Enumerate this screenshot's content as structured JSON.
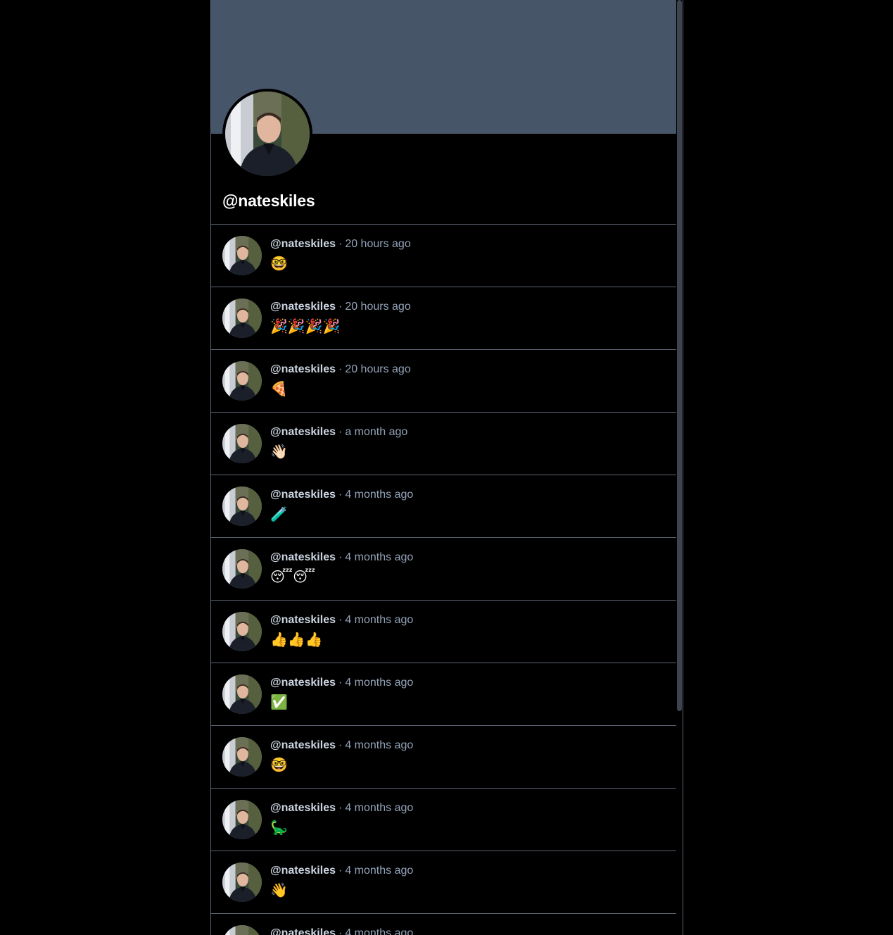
{
  "profile": {
    "handle": "@nateskiles",
    "banner_color": "#475569"
  },
  "separator": "·",
  "posts": [
    {
      "handle": "@nateskiles",
      "time": "20 hours ago",
      "body": "🤓"
    },
    {
      "handle": "@nateskiles",
      "time": "20 hours ago",
      "body": "🎉🎉🎉🎉"
    },
    {
      "handle": "@nateskiles",
      "time": "20 hours ago",
      "body": "🍕"
    },
    {
      "handle": "@nateskiles",
      "time": "a month ago",
      "body": "👋🏻"
    },
    {
      "handle": "@nateskiles",
      "time": "4 months ago",
      "body": "🧪"
    },
    {
      "handle": "@nateskiles",
      "time": "4 months ago",
      "body": "😴😴"
    },
    {
      "handle": "@nateskiles",
      "time": "4 months ago",
      "body": "👍👍👍"
    },
    {
      "handle": "@nateskiles",
      "time": "4 months ago",
      "body": "✅"
    },
    {
      "handle": "@nateskiles",
      "time": "4 months ago",
      "body": "🤓"
    },
    {
      "handle": "@nateskiles",
      "time": "4 months ago",
      "body": "🦕"
    },
    {
      "handle": "@nateskiles",
      "time": "4 months ago",
      "body": "👋"
    },
    {
      "handle": "@nateskiles",
      "time": "4 months ago",
      "body": ""
    }
  ]
}
